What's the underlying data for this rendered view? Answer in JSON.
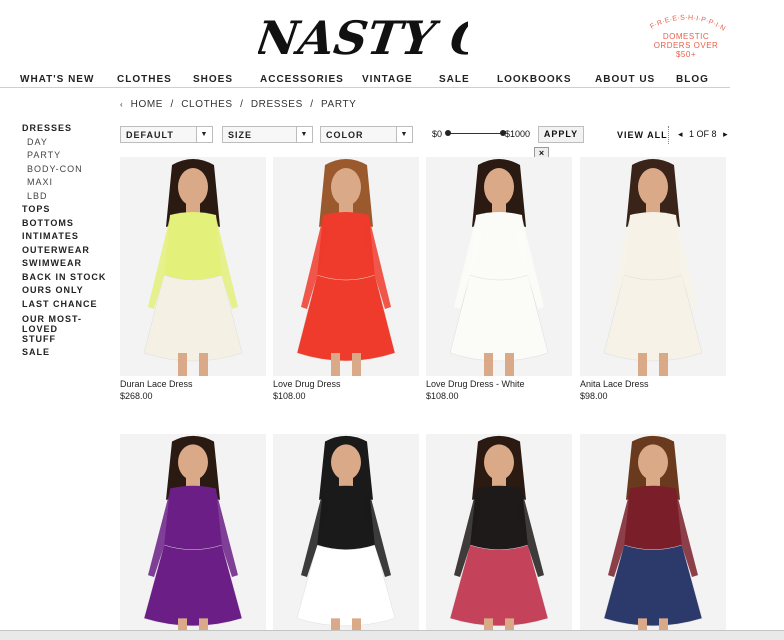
{
  "brand": {
    "logo_text": "NASTY GAL"
  },
  "promo": {
    "arc_text": "F·R·E·E·S·H·I·P·P·I·N·G",
    "line1": "DOMESTIC",
    "line2": "ORDERS OVER",
    "line3": "$50+",
    "color": "#e8604c"
  },
  "topnav": [
    "WHAT'S NEW",
    "CLOTHES",
    "SHOES",
    "ACCESSORIES",
    "VINTAGE",
    "SALE",
    "LOOKBOOKS",
    "ABOUT US",
    "BLOG"
  ],
  "breadcrumb": {
    "arrow": "‹",
    "items": [
      "HOME",
      "/",
      "CLOTHES",
      "/",
      "DRESSES",
      "/",
      "PARTY"
    ]
  },
  "sidebar": {
    "dresses": "DRESSES",
    "dress_subs": [
      "DAY",
      "PARTY",
      "BODY-CON",
      "MAXI",
      "LBD"
    ],
    "cats": [
      "TOPS",
      "BOTTOMS",
      "INTIMATES",
      "OUTERWEAR",
      "SWIMWEAR",
      "BACK IN STOCK",
      "OURS ONLY",
      "LAST CHANCE"
    ],
    "most_loved_1": "OUR MOST-LOVED",
    "most_loved_2": "STUFF",
    "sale": "SALE"
  },
  "filters": {
    "sort": "DEFAULT",
    "size": "SIZE",
    "color": "COLOR",
    "price_min": "$0",
    "price_max": "$1000",
    "apply": "APPLY",
    "close": "×"
  },
  "pagination": {
    "view_all": "VIEW ALL",
    "prev": "◂",
    "label": "1 OF 8",
    "next": "▸"
  },
  "products": [
    {
      "name": "Duran Lace Dress",
      "price": "$268.00",
      "color": "#e3f07a",
      "accent": "#f4f1e4",
      "hair": "#2a1a12"
    },
    {
      "name": "Love Drug Dress",
      "price": "$108.00",
      "color": "#ee3b2b",
      "accent": "#ee3b2b",
      "hair": "#9a5a2e"
    },
    {
      "name": "Love Drug Dress - White",
      "price": "$108.00",
      "color": "#fbfbf8",
      "accent": "#fbfbf8",
      "hair": "#2a1a12"
    },
    {
      "name": "Anita Lace Dress",
      "price": "$98.00",
      "color": "#f6f2e8",
      "accent": "#f6f2e8",
      "hair": "#3a2318"
    },
    {
      "name": "",
      "price": "",
      "color": "#6a1e86",
      "accent": "#6a1e86",
      "hair": "#2a1a12"
    },
    {
      "name": "",
      "price": "",
      "color": "#1a1a1a",
      "accent": "#ffffff",
      "hair": "#1a1a1a"
    },
    {
      "name": "",
      "price": "",
      "color": "#1e1a1a",
      "accent": "#c4425a",
      "hair": "#2a1a12"
    },
    {
      "name": "",
      "price": "",
      "color": "#7a1e2a",
      "accent": "#2b3a6a",
      "hair": "#6a3a1e"
    }
  ]
}
